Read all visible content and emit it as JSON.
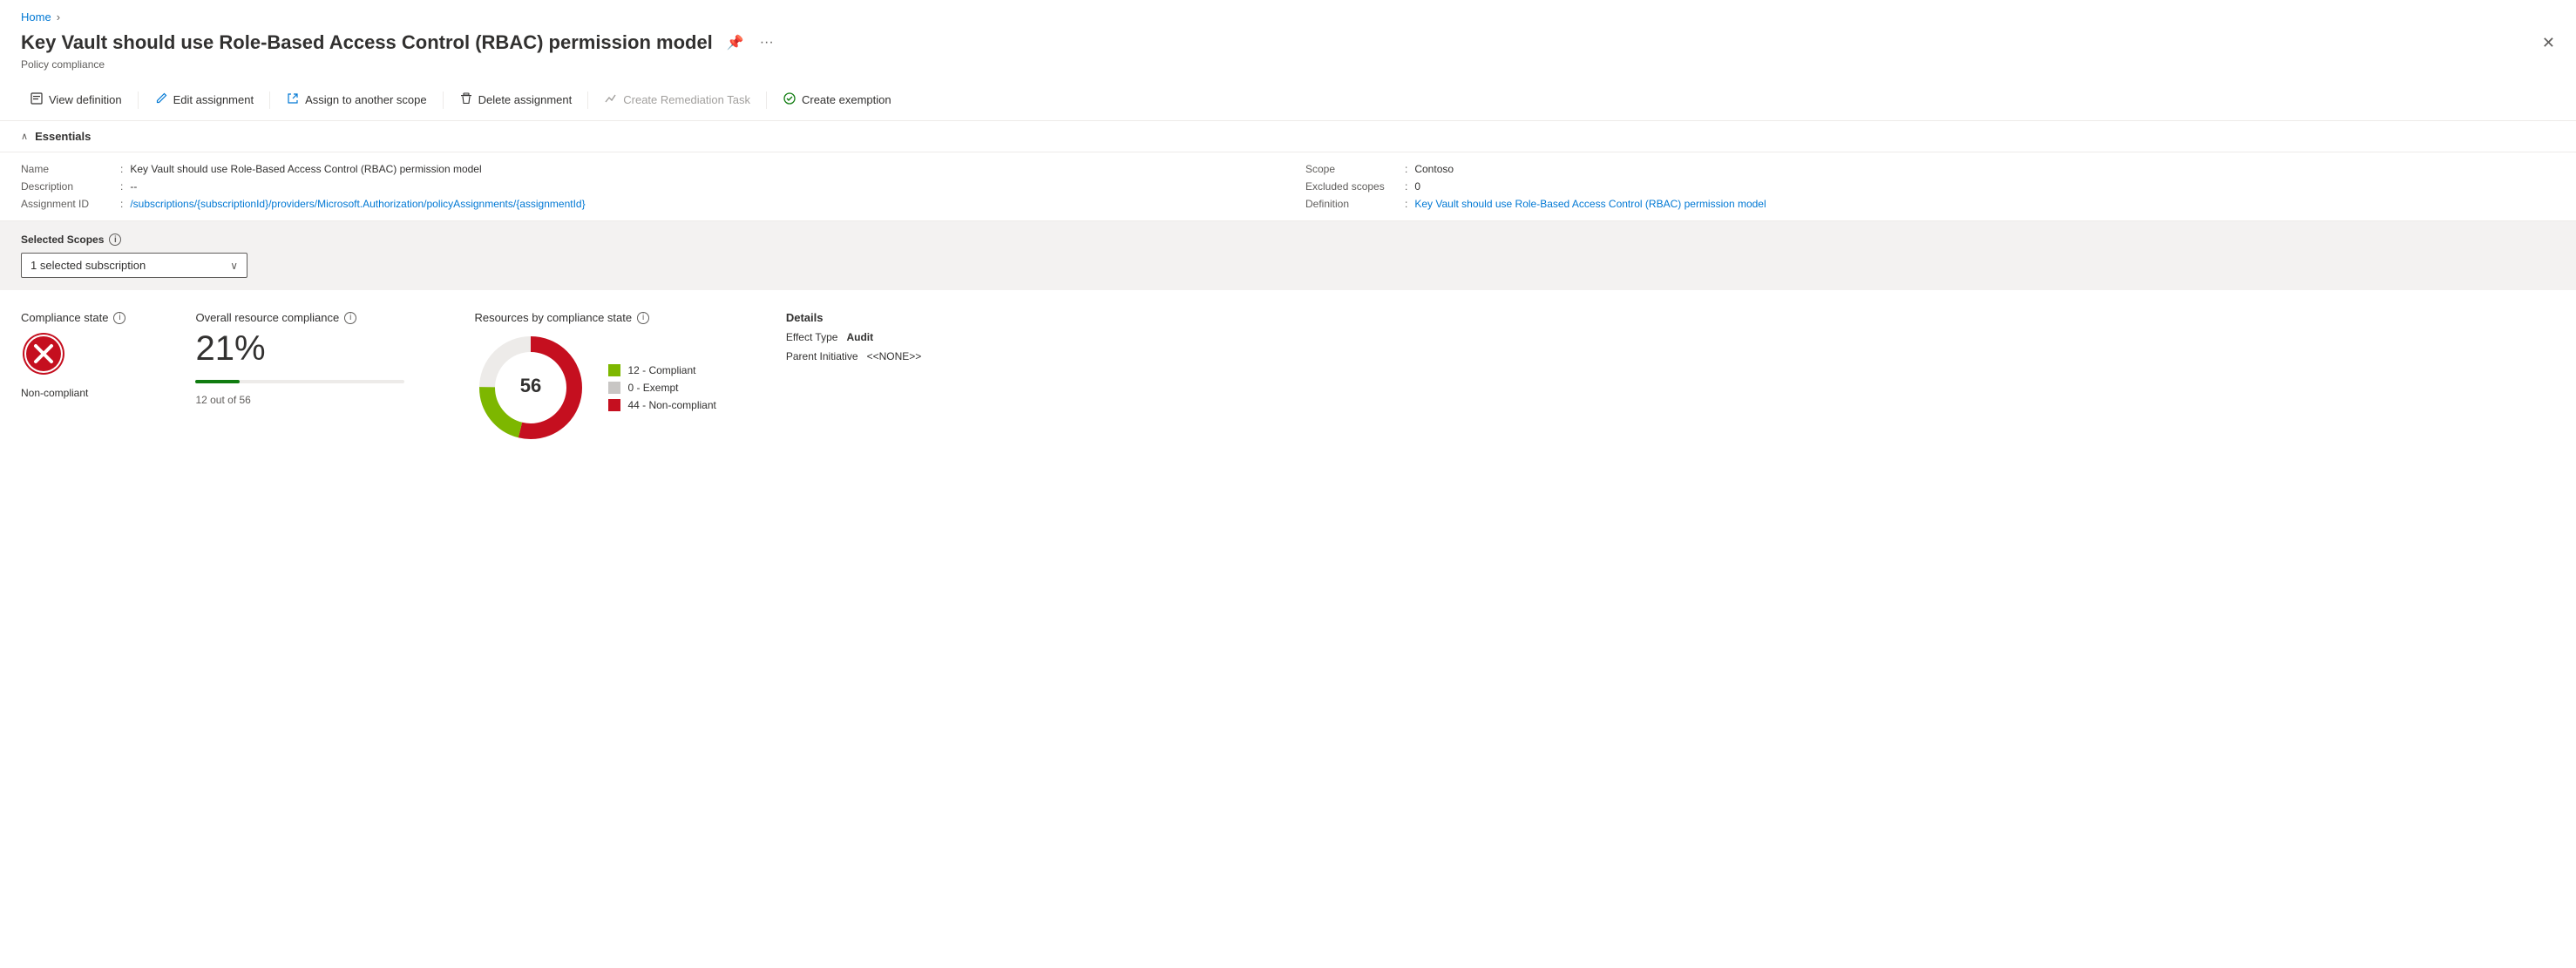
{
  "breadcrumb": {
    "home": "Home",
    "separator": "›"
  },
  "page": {
    "title": "Key Vault should use Role-Based Access Control (RBAC) permission model",
    "subtitle": "Policy compliance"
  },
  "toolbar": {
    "view_definition": "View definition",
    "edit_assignment": "Edit assignment",
    "assign_to_scope": "Assign to another scope",
    "delete_assignment": "Delete assignment",
    "create_remediation": "Create Remediation Task",
    "create_exemption": "Create exemption"
  },
  "essentials": {
    "title": "Essentials",
    "fields": {
      "name_label": "Name",
      "name_value": "Key Vault should use Role-Based Access Control (RBAC) permission model",
      "description_label": "Description",
      "description_value": "--",
      "assignment_id_label": "Assignment ID",
      "assignment_id_value": "/subscriptions/{subscriptionId}/providers/Microsoft.Authorization/policyAssignments/{assignmentId}",
      "scope_label": "Scope",
      "scope_value": "Contoso",
      "excluded_scopes_label": "Excluded scopes",
      "excluded_scopes_value": "0",
      "definition_label": "Definition",
      "definition_value": "Key Vault should use Role-Based Access Control (RBAC) permission model"
    }
  },
  "scopes": {
    "label": "Selected Scopes",
    "dropdown_value": "1 selected subscription"
  },
  "compliance_state": {
    "title": "Compliance state",
    "status": "Non-compliant"
  },
  "overall_compliance": {
    "title": "Overall resource compliance",
    "percentage": "21%",
    "detail": "12 out of 56"
  },
  "resources_by_state": {
    "title": "Resources by compliance state",
    "total": "56",
    "legend": [
      {
        "label": "12 - Compliant",
        "color": "#7db700"
      },
      {
        "label": "0 - Exempt",
        "color": "#c8c6c4"
      },
      {
        "label": "44 - Non-compliant",
        "color": "#c50f1f"
      }
    ]
  },
  "details": {
    "title": "Details",
    "effect_type_label": "Effect Type",
    "effect_type_value": "Audit",
    "parent_initiative_label": "Parent Initiative",
    "parent_initiative_value": "<<NONE>>"
  },
  "icons": {
    "pin": "📌",
    "more": "···",
    "close": "✕",
    "view_def": "⬜",
    "edit": "✏️",
    "assign": "↗",
    "delete": "🗑",
    "remediation": "📈",
    "exemption": "✅"
  }
}
